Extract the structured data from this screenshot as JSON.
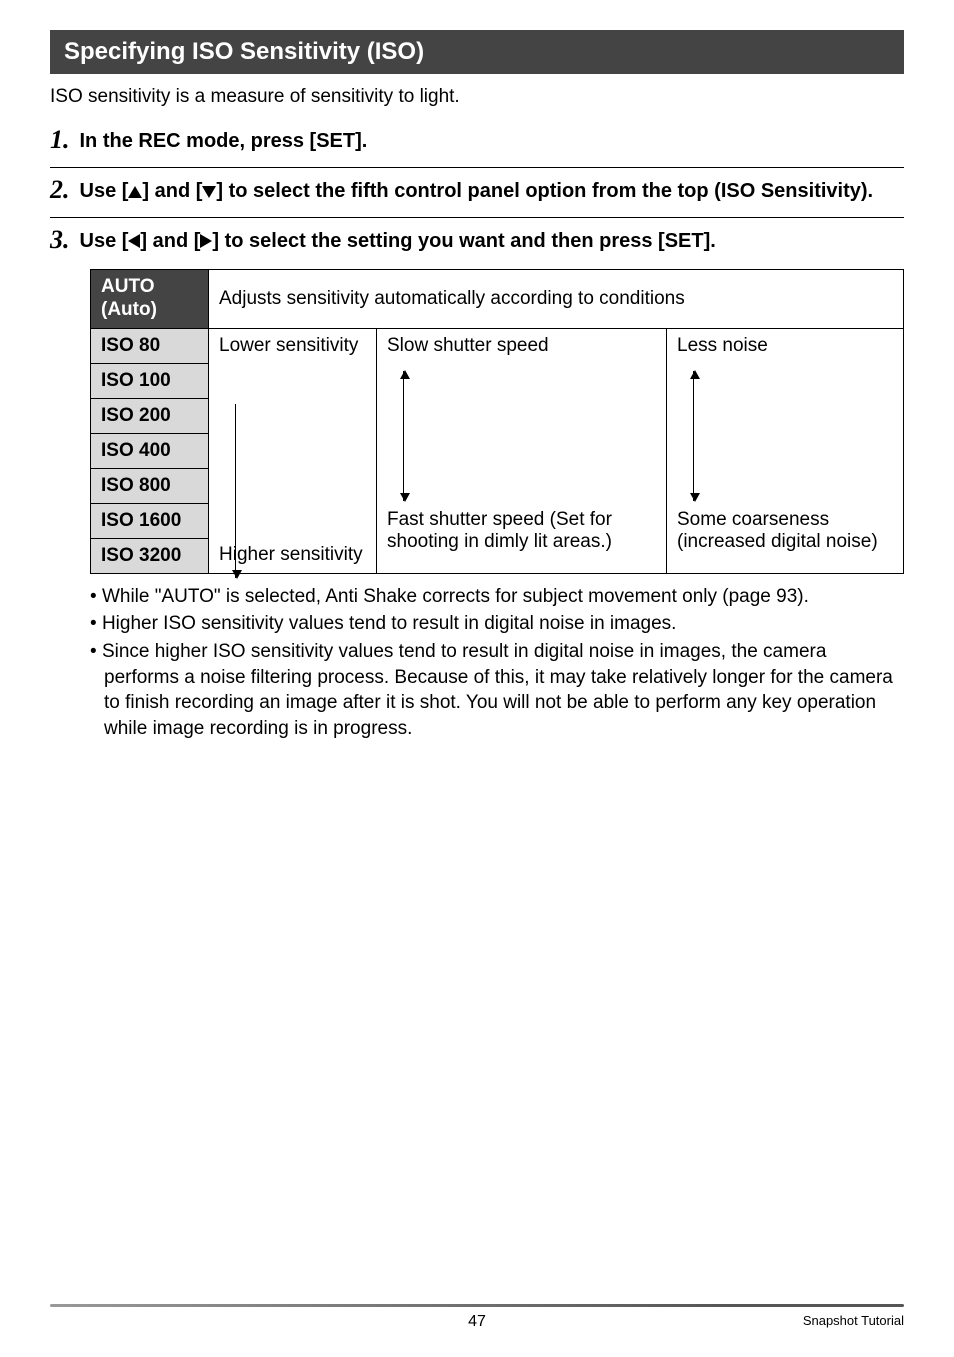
{
  "header": {
    "title": "Specifying ISO Sensitivity (ISO)"
  },
  "intro": "ISO sensitivity is a measure of sensitivity to light.",
  "steps": [
    {
      "num": "1.",
      "text": "In the REC mode, press [SET]."
    },
    {
      "num": "2.",
      "text_pre": "Use [",
      "text_mid": "] and [",
      "text_post": "] to select the fifth control panel option from the top (ISO Sensitivity)."
    },
    {
      "num": "3.",
      "text_pre": "Use [",
      "text_mid": "] and [",
      "text_post": "] to select the setting you want and then press [SET]."
    }
  ],
  "table": {
    "auto_label1": "AUTO",
    "auto_label2": "(Auto)",
    "auto_desc": "Adjusts sensitivity automatically according to conditions",
    "rows": [
      "ISO 80",
      "ISO 100",
      "ISO 200",
      "ISO 400",
      "ISO 800",
      "ISO 1600",
      "ISO 3200"
    ],
    "sens_top": "Lower sensitivity",
    "sens_bot": "Higher sensitivity",
    "shutter_top": "Slow shutter speed",
    "shutter_bot": "Fast shutter speed (Set for shooting in dimly lit areas.)",
    "noise_top": "Less noise",
    "noise_bot": "Some coarseness (increased digital noise)"
  },
  "bullets": [
    "While \"AUTO\" is selected, Anti Shake corrects for subject movement only (page 93).",
    "Higher ISO sensitivity values tend to result in digital noise in images.",
    "Since higher ISO sensitivity values tend to result in digital noise in images, the camera performs a noise filtering process. Because of this, it may take relatively longer for the camera to finish recording an image after it is shot. You will not be able to perform any key operation while image recording is in progress."
  ],
  "footer": {
    "page": "47",
    "section": "Snapshot Tutorial"
  }
}
